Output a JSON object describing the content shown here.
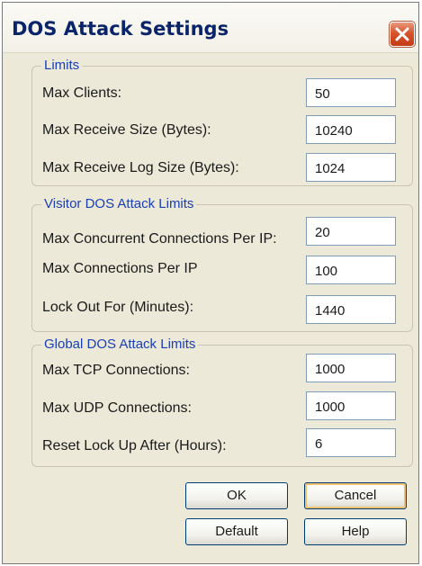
{
  "dialog": {
    "title": "DOS Attack Settings",
    "close_icon": "close-icon"
  },
  "groups": {
    "limits": {
      "legend": "Limits",
      "rows": [
        {
          "label": "Max Clients:",
          "value": "50"
        },
        {
          "label": "Max Receive Size (Bytes):",
          "value": "10240"
        },
        {
          "label": "Max Receive Log Size (Bytes):",
          "value": "1024"
        }
      ]
    },
    "visitor": {
      "legend": "Visitor DOS Attack Limits",
      "rows": [
        {
          "label": "Max Concurrent Connections Per IP:",
          "value": "20"
        },
        {
          "label": "Max Connections Per IP",
          "value": "100"
        },
        {
          "label": "Lock Out For (Minutes):",
          "value": "1440"
        }
      ]
    },
    "global": {
      "legend": "Global DOS Attack Limits",
      "rows": [
        {
          "label": "Max TCP Connections:",
          "value": "1000"
        },
        {
          "label": "Max UDP Connections:",
          "value": "1000"
        },
        {
          "label": "Reset Lock Up After (Hours):",
          "value": "6"
        }
      ]
    }
  },
  "buttons": {
    "ok": "OK",
    "cancel": "Cancel",
    "default": "Default",
    "help": "Help"
  },
  "colors": {
    "title": "#0a246a",
    "group_legend": "#1a3fb5",
    "close_button": "#d6542c",
    "dialog_background": "#ece9d8",
    "field_border": "#7f9db9"
  }
}
